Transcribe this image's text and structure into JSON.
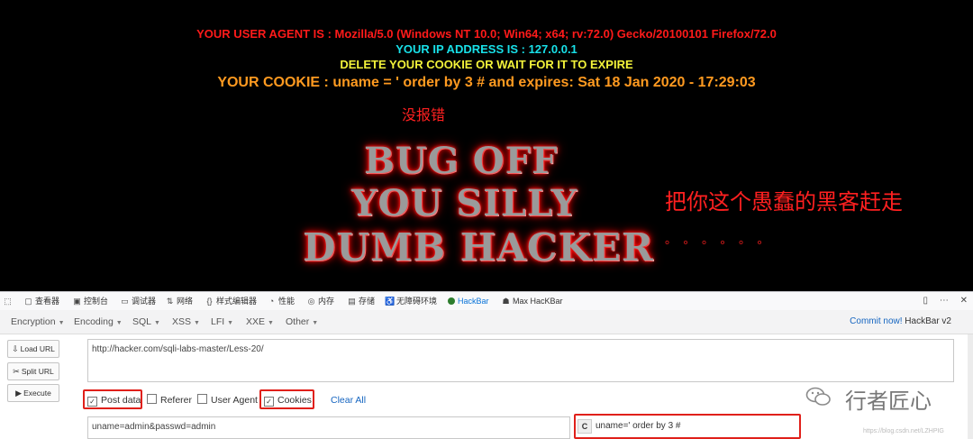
{
  "page": {
    "user_agent_line": "YOUR USER AGENT IS : Mozilla/5.0 (Windows NT 10.0; Win64; x64; rv:72.0) Gecko/20100101 Firefox/72.0",
    "ip_line": "YOUR IP ADDRESS IS : 127.0.0.1",
    "delete_line": "DELETE YOUR COOKIE OR WAIT FOR IT TO EXPIRE",
    "cookie_line": "YOUR COOKIE : uname = ' order by 3 # and expires: Sat 18 Jan 2020 - 17:29:03",
    "annotation_no_error": "没报错",
    "bug_off_lines": [
      "BUG OFF",
      "YOU SILLY",
      "DUMB HACKER"
    ],
    "annotation_right": "把你这个愚蠢的黑客赶走",
    "annotation_dots": "。。。。。。",
    "colors": {
      "user_agent": "#ff1a1a",
      "ip": "#18e0e8",
      "delete": "#f3f33a",
      "cookie": "#ff9a20",
      "annotation": "#ff2020"
    }
  },
  "devtools": {
    "tabs": [
      {
        "icon": "inspector-icon",
        "label": "查看器"
      },
      {
        "icon": "console-icon",
        "label": "控制台"
      },
      {
        "icon": "debugger-icon",
        "label": "调试器"
      },
      {
        "icon": "network-icon",
        "label": "网络"
      },
      {
        "icon": "style-editor-icon",
        "label": "样式编辑器"
      },
      {
        "icon": "performance-icon",
        "label": "性能"
      },
      {
        "icon": "memory-icon",
        "label": "内存"
      },
      {
        "icon": "storage-icon",
        "label": "存储"
      },
      {
        "icon": "accessibility-icon",
        "label": "无障碍环境"
      },
      {
        "icon": "hackbar-icon",
        "label": "HackBar"
      },
      {
        "icon": "max-hackbar-icon",
        "label": "Max HacKBar"
      }
    ],
    "active_tab": "HackBar"
  },
  "hackbar": {
    "menus": [
      "Encryption",
      "Encoding",
      "SQL",
      "XSS",
      "LFI",
      "XXE",
      "Other"
    ],
    "commit_link": "Commit now!",
    "commit_suffix": " HackBar v2",
    "buttons": {
      "load": "Load URL",
      "split": "Split URL",
      "execute": "Execute"
    },
    "url": "http://hacker.com/sqli-labs-master/Less-20/",
    "options": [
      {
        "label": "Post data",
        "checked": true
      },
      {
        "label": "Referer",
        "checked": false
      },
      {
        "label": "User Agent",
        "checked": false
      },
      {
        "label": "Cookies",
        "checked": true
      }
    ],
    "clear_all": "Clear All",
    "post_data": "uname=admin&passwd=admin",
    "cookie_badge": "C",
    "cookie_value": "uname=' order by 3 #"
  },
  "watermark": {
    "text": "行者匠心",
    "blog": "https://blog.csdn.net/LZHPIG"
  }
}
